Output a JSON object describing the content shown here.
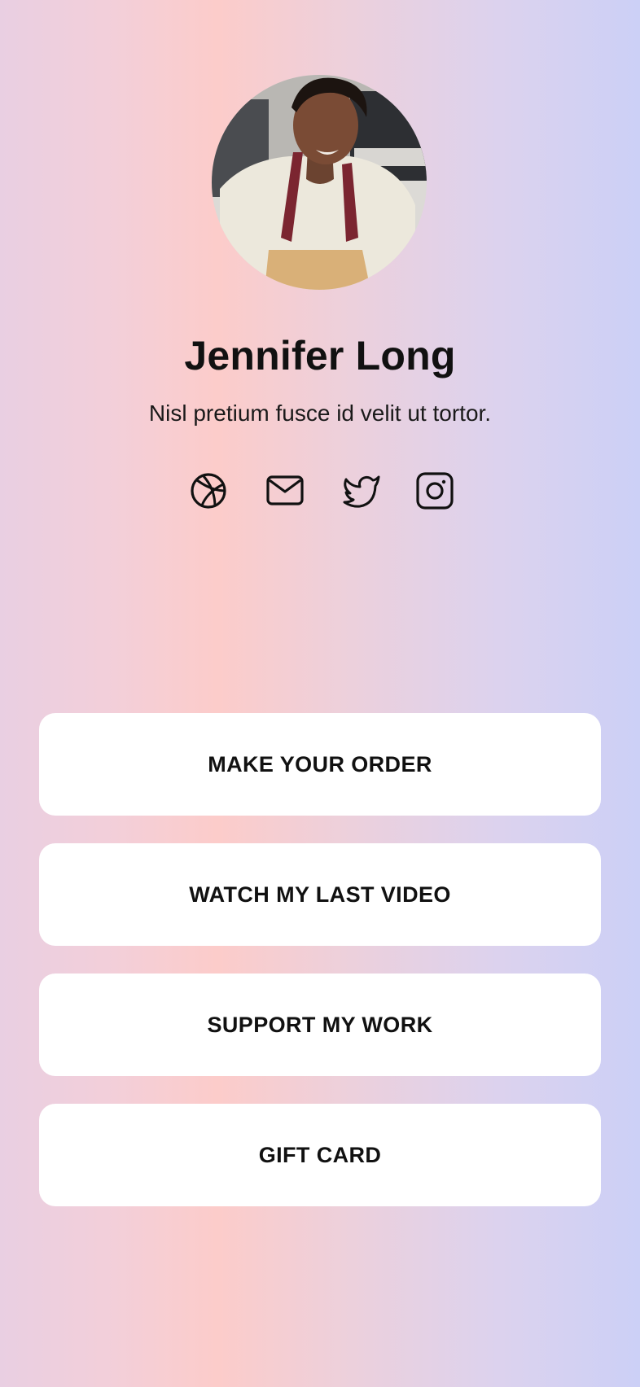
{
  "profile": {
    "name": "Jennifer Long",
    "bio": "Nisl pretium fusce id velit ut tortor."
  },
  "socials": [
    {
      "icon": "dribbble-icon"
    },
    {
      "icon": "mail-icon"
    },
    {
      "icon": "twitter-icon"
    },
    {
      "icon": "instagram-icon"
    }
  ],
  "links": [
    {
      "label": "MAKE YOUR ORDER"
    },
    {
      "label": "WATCH MY LAST VIDEO"
    },
    {
      "label": "SUPPORT MY WORK"
    },
    {
      "label": "GIFT CARD"
    }
  ],
  "colors": {
    "gradient_left": "#e9cfe2",
    "gradient_mid": "#fcccca",
    "gradient_right": "#ccd0f6",
    "button_bg": "#ffffff",
    "text": "#111111"
  }
}
